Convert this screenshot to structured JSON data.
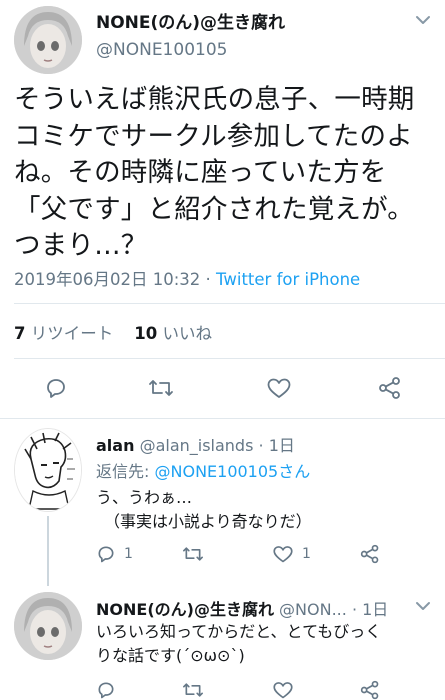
{
  "main_tweet": {
    "display_name": "NONE(のん)@生き腐れ",
    "handle": "@NONE100105",
    "text_lines": [
      "そういえば熊沢氏の息子、一時期",
      "コミケでサークル参加してたのよ",
      "ね。その時隣に座っていた方を",
      "「父です」と紹介された覚えが。",
      "つまり…？"
    ],
    "timestamp": "2019年06月02日 10:32",
    "separator": " · ",
    "client": "Twitter for iPhone",
    "retweet_count": "7",
    "retweet_label": "リツイート",
    "like_count": "10",
    "like_label": "いいね"
  },
  "reply_1": {
    "display_name": "alan",
    "handle": "@alan_islands",
    "time": "· 1日",
    "reply_to_label": "返信先:",
    "reply_to_mention": "@NONE100105さん",
    "text_lines": [
      "う、うわぁ…",
      "（事実は小説より奇なりだ）"
    ],
    "reply_count": "1",
    "retweet_count": "",
    "like_count": "1"
  },
  "reply_2": {
    "display_name": "NONE(のん)@生き腐れ",
    "handle": "@NON...",
    "time": "· 1日",
    "text_lines": [
      "いろいろ知ってからだと、とてもびっく",
      "りな話です(´⊙ω⊙`)"
    ]
  },
  "colors": {
    "accent": "#1da1f2",
    "muted": "#657786",
    "text": "#14171a",
    "divider": "#e1e8ed"
  },
  "icons": [
    "reply-icon",
    "retweet-icon",
    "like-icon",
    "share-icon",
    "caret-down-icon"
  ]
}
